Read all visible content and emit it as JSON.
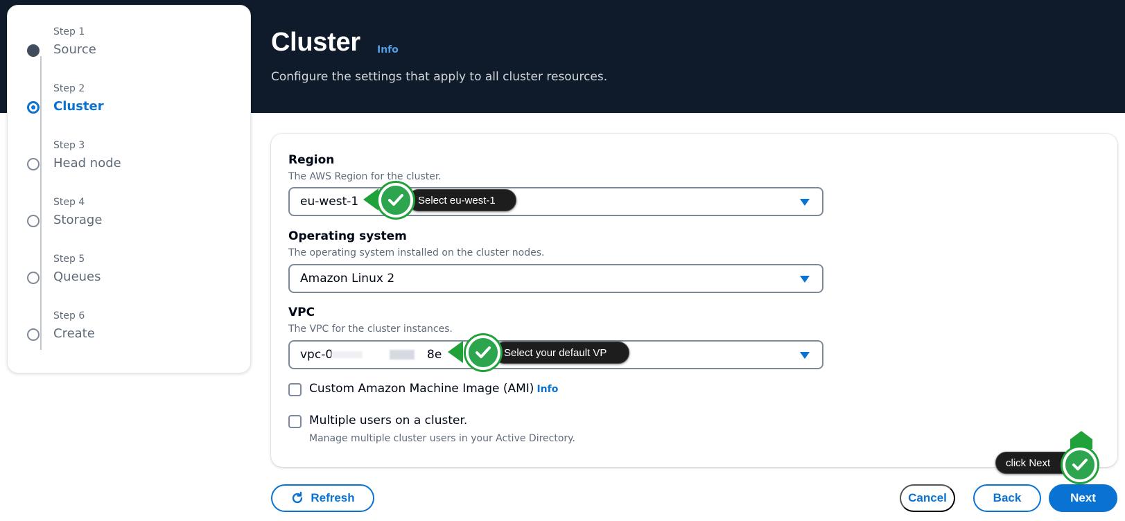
{
  "header": {
    "title": "Cluster",
    "info_link": "Info",
    "description": "Configure the settings that apply to all cluster resources."
  },
  "steps": [
    {
      "number": "Step 1",
      "label": "Source",
      "state": "completed"
    },
    {
      "number": "Step 2",
      "label": "Cluster",
      "state": "current"
    },
    {
      "number": "Step 3",
      "label": "Head node",
      "state": "pending"
    },
    {
      "number": "Step 4",
      "label": "Storage",
      "state": "pending"
    },
    {
      "number": "Step 5",
      "label": "Queues",
      "state": "pending"
    },
    {
      "number": "Step 6",
      "label": "Create",
      "state": "pending"
    }
  ],
  "form": {
    "region": {
      "label": "Region",
      "description": "The AWS Region for the cluster.",
      "value": "eu-west-1"
    },
    "os": {
      "label": "Operating system",
      "description": "The operating system installed on the cluster nodes.",
      "value": "Amazon Linux 2"
    },
    "vpc": {
      "label": "VPC",
      "description": "The VPC for the cluster instances.",
      "value_prefix": "vpc-0",
      "value_suffix": "8e"
    },
    "custom_ami": {
      "label": "Custom Amazon Machine Image (AMI)",
      "info_link": "Info",
      "checked": false
    },
    "multi_user": {
      "label": "Multiple users on a cluster.",
      "description": "Manage multiple cluster users in your Active Directory.",
      "checked": false
    }
  },
  "actions": {
    "refresh": "Refresh",
    "cancel": "Cancel",
    "back": "Back",
    "next": "Next"
  },
  "annotations": {
    "region": "Select eu-west-1",
    "vpc": "Select your default VP",
    "next": "click Next"
  },
  "colors": {
    "header_bg": "#0f1b2a",
    "accent": "#0972d3",
    "annotation_green": "#21a13a"
  },
  "icons": {
    "caret": "caret-down-icon",
    "refresh": "refresh-icon",
    "check": "check-icon"
  }
}
